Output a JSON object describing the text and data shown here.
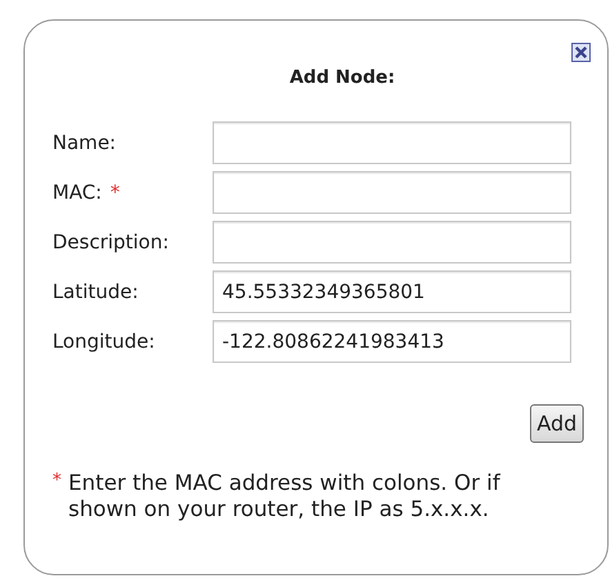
{
  "dialog": {
    "title": "Add Node:",
    "fields": [
      {
        "label": "Name:"
      },
      {
        "label": "MAC:",
        "marker": "*"
      },
      {
        "label": "Description:"
      },
      {
        "label": "Latitude:",
        "value": "45.55332349365801"
      },
      {
        "label": "Longitude:",
        "value": "-122.80862241983413"
      }
    ],
    "button": "Add",
    "note": {
      "marker": "*",
      "text": "Enter the MAC address with colons. Or if shown on your router, the IP as 5.x.x.x."
    }
  }
}
